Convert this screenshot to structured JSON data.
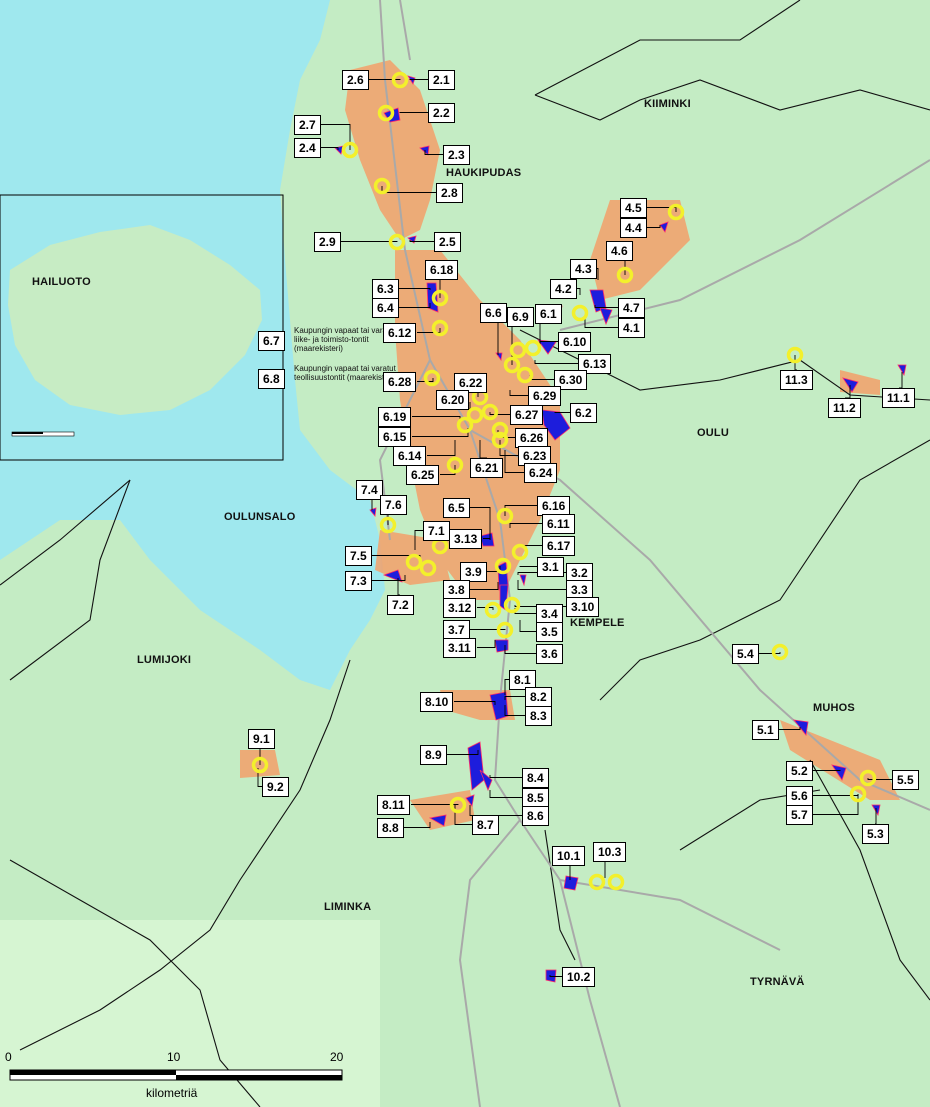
{
  "municipalities": {
    "kiiminki": "KIIMINKI",
    "haukipudas": "HAUKIPUDAS",
    "hailuoto": "HAILUOTO",
    "oulu": "OULU",
    "oulunsalo": "OULUNSALO",
    "kempele": "KEMPELE",
    "lumijoki": "LUMIJOKI",
    "muhos": "MUHOS",
    "liminka": "LIMINKA",
    "tyrnava": "TYRNÄVÄ"
  },
  "legend": {
    "code_a": "6.7",
    "text_a": "Kaupungin vapaat tai varatut liike- ja toimisto-tontit (maarekisteri)",
    "code_b": "6.8",
    "text_b": "Kaupungin vapaat tai varatut teollisuustontit (maarekisteri)"
  },
  "scale": {
    "t0": "0",
    "t10": "10",
    "t20": "20",
    "unit": "kilometriä"
  },
  "labels": [
    "2.6",
    "2.1",
    "2.2",
    "2.7",
    "2.4",
    "2.3",
    "2.8",
    "2.9",
    "2.5",
    "4.5",
    "4.4",
    "4.6",
    "4.3",
    "4.2",
    "4.7",
    "4.1",
    "6.18",
    "6.3",
    "6.4",
    "6.6",
    "6.9",
    "6.1",
    "6.12",
    "6.10",
    "6.13",
    "6.28",
    "6.22",
    "6.30",
    "6.20",
    "6.29",
    "6.19",
    "6.27",
    "6.2",
    "6.15",
    "6.26",
    "6.14",
    "6.23",
    "6.21",
    "6.25",
    "6.24",
    "11.3",
    "11.2",
    "11.1",
    "7.4",
    "7.6",
    "6.5",
    "6.16",
    "6.11",
    "7.1",
    "3.13",
    "6.17",
    "7.5",
    "3.9",
    "3.1",
    "3.2",
    "7.3",
    "3.8",
    "3.3",
    "7.2",
    "3.12",
    "3.10",
    "3.4",
    "3.7",
    "3.5",
    "3.11",
    "3.6",
    "5.4",
    "8.1",
    "8.10",
    "8.2",
    "8.3",
    "5.1",
    "9.1",
    "8.9",
    "8.4",
    "5.2",
    "5.5",
    "9.2",
    "8.5",
    "5.6",
    "8.11",
    "8.6",
    "5.7",
    "8.8",
    "8.7",
    "5.3",
    "10.1",
    "10.3",
    "10.2"
  ],
  "colors": {
    "sea": "#9fe8ee",
    "land": "#c4ecc4",
    "urban": "#f3a06a",
    "plot": "#1d1ddc",
    "marker": "#f3f02b"
  }
}
